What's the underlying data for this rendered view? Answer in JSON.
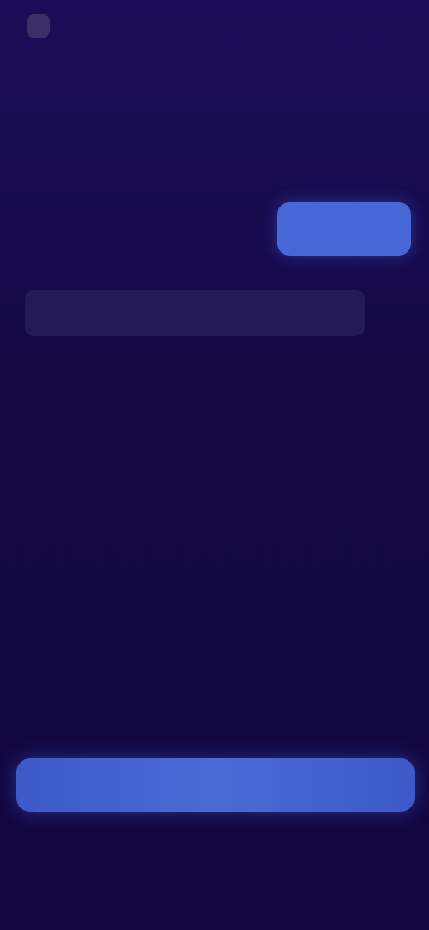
{
  "header": {
    "logo_icon": "app-logo-icon",
    "logo_text": "",
    "top_link": ""
  },
  "main": {
    "headline": "",
    "subtitle": "",
    "options": [
      {
        "label": "",
        "selected": false
      },
      {
        "label": "",
        "selected": false
      },
      {
        "label": "",
        "selected": true
      }
    ],
    "info_text": ""
  },
  "footer": {
    "terms_text": "",
    "cta_label": "",
    "secondary_link": ""
  },
  "colors": {
    "background": "#130840",
    "accent": "#4667d6",
    "panel": "#241a5a"
  }
}
